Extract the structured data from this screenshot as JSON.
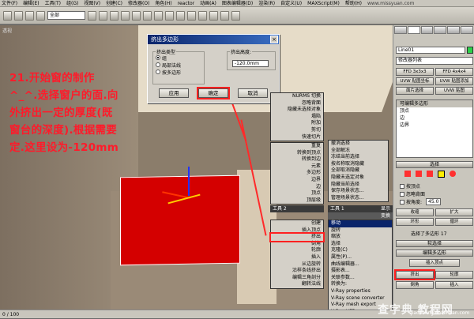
{
  "menubar": {
    "items": [
      "文件(F)",
      "编辑(E)",
      "工具(T)",
      "组(G)",
      "视图(V)",
      "创建(C)",
      "修改器(O)",
      "角色(H)",
      "reactor",
      "动画(A)",
      "图表编辑器(D)",
      "渲染(R)",
      "自定义(U)",
      "MAXScript(M)",
      "帮助(H)"
    ],
    "watermark": "www.missyuan.com"
  },
  "toolbar": {
    "select_filter": "全部"
  },
  "viewport": {
    "label": "透视",
    "instruction": "21.开始窗的制作^_^.选择窗户的面.向外挤出一定的厚度(既窗台的深度).根据需要定.这里设为-120mm"
  },
  "dialog": {
    "title": "挤出多边形",
    "extrude_type_label": "挤出类型",
    "options": [
      "组",
      "局部法线",
      "按多边形"
    ],
    "selected_option": 0,
    "height_label": "挤出高度:",
    "height_value": "-120.0mm",
    "apply": "应用",
    "ok": "确定",
    "cancel": "取消"
  },
  "quad_left": {
    "items_top": [
      "NURMS 切换",
      "忽略背面",
      "隐藏未选择对象",
      "塌陷",
      "附加",
      "剪切",
      "快速切片"
    ],
    "items_mid": [
      "重复",
      "转换到顶点",
      "转换到边",
      "元素",
      "多边形",
      "边界",
      "边",
      "顶点",
      "顶层级"
    ],
    "tool2": "工具 2",
    "items_bot": [
      "创建",
      "插入顶点",
      "挤出",
      "倒角",
      "轮廓",
      "插入",
      "从边旋转",
      "沿样条线挤出",
      "编辑三角剖分",
      "翻转法线"
    ]
  },
  "quad_right": {
    "items_top": [
      "撤消选择",
      "全部解冻",
      "冻结当前选择",
      "按名称取消隐藏",
      "全部取消隐藏",
      "隐藏未选定对象",
      "隐藏当前选择",
      "保存场景状态...",
      "管理场景状态..."
    ],
    "tool1": "工具 1",
    "display": "显示",
    "transform": "变换",
    "items_bot": [
      "移动",
      "旋转",
      "缩放",
      "选择",
      "克隆(C)",
      "属性(P)...",
      "曲线编辑器...",
      "摄影表...",
      "关联参数...",
      "转换为:",
      "V-Ray properties",
      "V-Ray scene converter",
      "V-Ray mesh export",
      "V-Ray VFB"
    ]
  },
  "panel": {
    "object_name": "Line01",
    "modifier_list": "修改器列表",
    "buttons_row1": [
      "FFD 3x3x3",
      "FFD 4x4x4"
    ],
    "buttons_row2": [
      "UVW 贴图坐标",
      "UVW 贴图添加"
    ],
    "buttons_row3": [
      "面片选择",
      "UVW 贴图"
    ],
    "stack": [
      "可编辑多边形",
      "顶点",
      "边",
      "边界"
    ],
    "select_rollout": "选择",
    "by_vertex": "按顶点",
    "ignore_back": "忽略背面",
    "by_angle": "按角度:",
    "angle_value": "45.0",
    "shrink": "收缩",
    "grow": "扩大",
    "ring": "环形",
    "loop": "循环",
    "selected_count": "选择了多边形 17",
    "soft_select": "软选择",
    "edit_poly": "编辑多边形",
    "insert_vertex": "插入顶点",
    "extrude": "挤出",
    "outline": "轮廓",
    "bevel": "倒角",
    "inset": "插入"
  },
  "status": {
    "frame": "0 / 100"
  },
  "watermark": {
    "main": "查字典 教程网",
    "sub": "jiaocheng.chazidian.com"
  }
}
